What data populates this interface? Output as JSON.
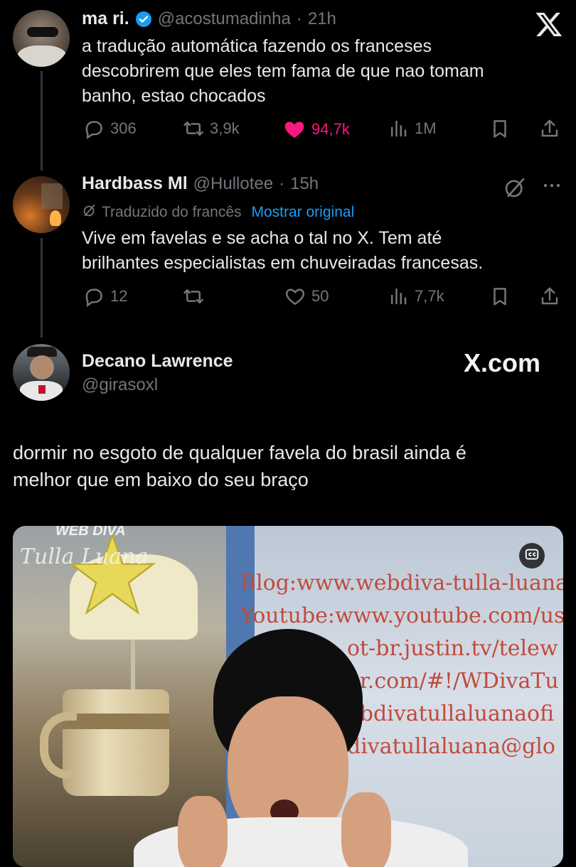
{
  "tweet1": {
    "name": "ma ri.",
    "handle": "@acostumadinha",
    "time": "21h",
    "text_lines": [
      "a tradução automática fazendo os franceses",
      "descobrirem que eles tem fama de que nao tomam",
      "banho, estao chocados"
    ],
    "replies": "306",
    "reposts": "3,9k",
    "likes": "94,7k",
    "views": "1M",
    "like_color": "#f91880"
  },
  "tweet2": {
    "name": "Hardbass Ml",
    "handle": "@Hullotee",
    "time": "15h",
    "translated_label": "Traduzido do francês",
    "show_original": "Mostrar original",
    "text_lines": [
      "Vive em favelas e se acha o tal no X. Tem até",
      "brilhantes especialistas em chuveiradas francesas."
    ],
    "replies": "12",
    "reposts": "",
    "likes": "50",
    "views": "7,7k"
  },
  "quote": {
    "name": "Decano Lawrence",
    "handle": "@girasoxl",
    "watermark": "X.com",
    "text_lines": [
      "dormir no esgoto de qualquer favela do brasil ainda é",
      "melhor que em baixo do seu braço"
    ]
  },
  "media": {
    "sign_lines": [
      "Blog:www.webdiva-tulla-luana.bl",
      "Youtube:www.youtube.com/use",
      "ot-br.justin.tv/telew",
      "er.com/#!/WDivaTu",
      "ebdivatullaluanaofi",
      "divatullaluana@glo"
    ],
    "logo_top": "WEB DIVA",
    "logo_bottom": "Tulla Luana"
  },
  "icons": {
    "close": "x-logo-icon",
    "verified": "verified-badge-icon"
  },
  "colors": {
    "accent": "#1d9bf0",
    "like": "#f91880",
    "muted": "#71767b"
  }
}
